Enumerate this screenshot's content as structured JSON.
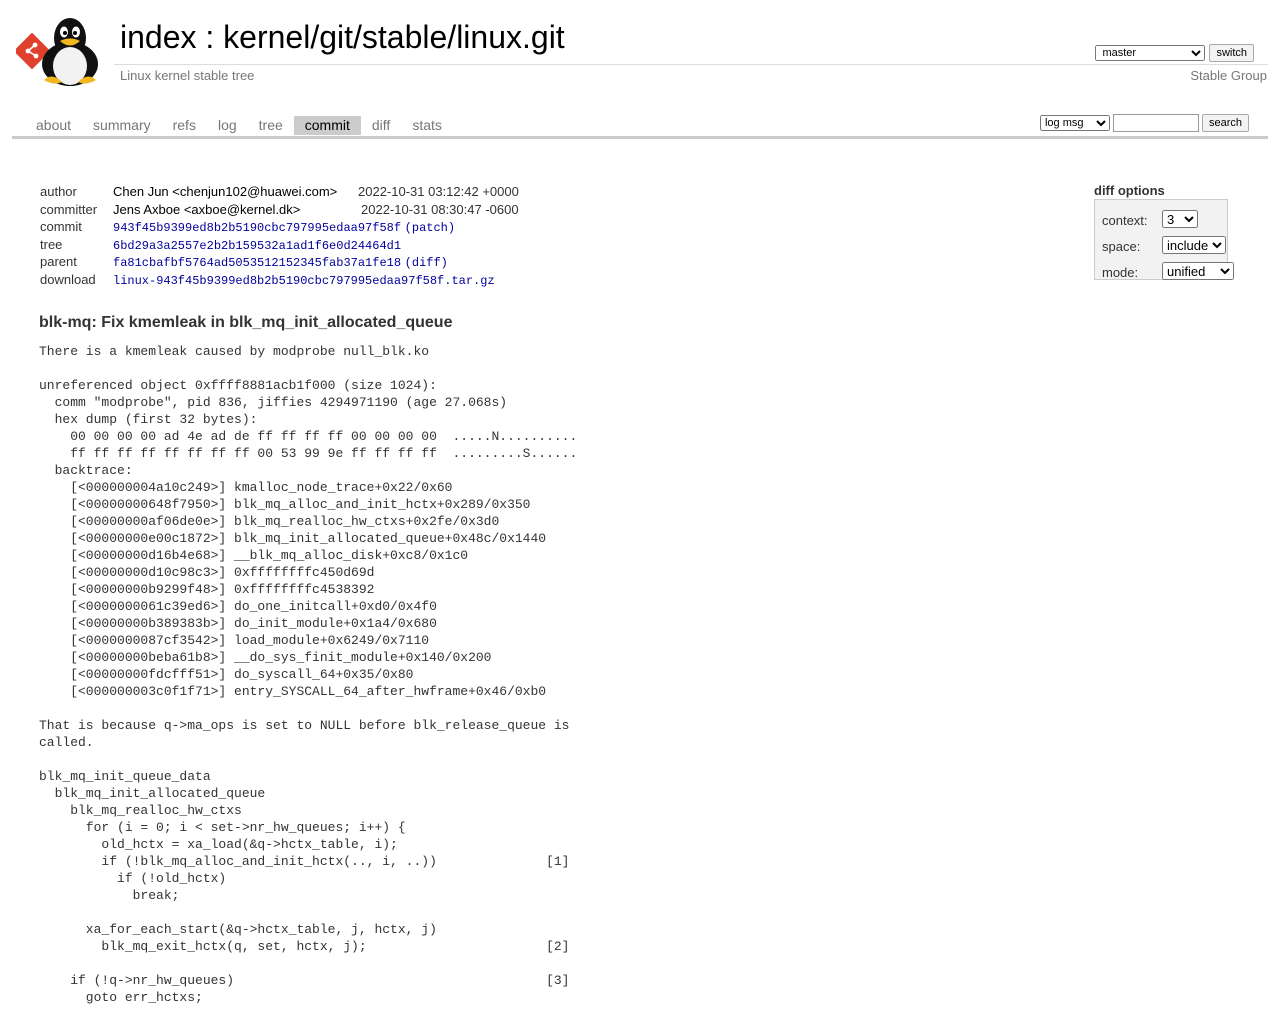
{
  "header": {
    "index_link": "index",
    "separator": " : ",
    "repo_link": "kernel/git/stable/linux.git",
    "subtitle": "Linux kernel stable tree",
    "owner": "Stable Group",
    "branch_selected": "master",
    "switch_label": "switch"
  },
  "tabs": [
    {
      "label": "about"
    },
    {
      "label": "summary"
    },
    {
      "label": "refs"
    },
    {
      "label": "log"
    },
    {
      "label": "tree"
    },
    {
      "label": "commit",
      "active": true
    },
    {
      "label": "diff"
    },
    {
      "label": "stats"
    }
  ],
  "search": {
    "mode_selected": "log msg",
    "query": "",
    "button_label": "search"
  },
  "diff_options": {
    "heading": "diff options",
    "context_label": "context:",
    "context_value": "3",
    "space_label": "space:",
    "space_value": "include",
    "mode_label": "mode:",
    "mode_value": "unified"
  },
  "commit_info": {
    "author_label": "author",
    "author": "Chen Jun <chenjun102@huawei.com>",
    "author_date": "2022-10-31 03:12:42 +0000",
    "committer_label": "committer",
    "committer": "Jens Axboe <axboe@kernel.dk>",
    "committer_date": "2022-10-31 08:30:47 -0600",
    "commit_label": "commit",
    "commit_hash": "943f45b9399ed8b2b5190cbc797995edaa97f58f",
    "patch_link": "(patch)",
    "tree_label": "tree",
    "tree_hash": "6bd29a3a2557e2b2b159532a1ad1f6e0d24464d1",
    "parent_label": "parent",
    "parent_hash": "fa81cbafbf5764ad5053512152345fab37a1fe18",
    "diff_link": "(diff)",
    "download_label": "download",
    "download_file": "linux-943f45b9399ed8b2b5190cbc797995edaa97f58f.tar.gz"
  },
  "subject": "blk-mq: Fix kmemleak in blk_mq_init_allocated_queue",
  "message": "There is a kmemleak caused by modprobe null_blk.ko\n\nunreferenced object 0xffff8881acb1f000 (size 1024):\n  comm \"modprobe\", pid 836, jiffies 4294971190 (age 27.068s)\n  hex dump (first 32 bytes):\n    00 00 00 00 ad 4e ad de ff ff ff ff 00 00 00 00  .....N..........\n    ff ff ff ff ff ff ff ff 00 53 99 9e ff ff ff ff  .........S......\n  backtrace:\n    [<000000004a10c249>] kmalloc_node_trace+0x22/0x60\n    [<00000000648f7950>] blk_mq_alloc_and_init_hctx+0x289/0x350\n    [<00000000af06de0e>] blk_mq_realloc_hw_ctxs+0x2fe/0x3d0\n    [<00000000e00c1872>] blk_mq_init_allocated_queue+0x48c/0x1440\n    [<00000000d16b4e68>] __blk_mq_alloc_disk+0xc8/0x1c0\n    [<00000000d10c98c3>] 0xffffffffc450d69d\n    [<00000000b9299f48>] 0xffffffffc4538392\n    [<0000000061c39ed6>] do_one_initcall+0xd0/0x4f0\n    [<00000000b389383b>] do_init_module+0x1a4/0x680\n    [<0000000087cf3542>] load_module+0x6249/0x7110\n    [<00000000beba61b8>] __do_sys_finit_module+0x140/0x200\n    [<00000000fdcfff51>] do_syscall_64+0x35/0x80\n    [<000000003c0f1f71>] entry_SYSCALL_64_after_hwframe+0x46/0xb0\n\nThat is because q->ma_ops is set to NULL before blk_release_queue is\ncalled.\n\nblk_mq_init_queue_data\n  blk_mq_init_allocated_queue\n    blk_mq_realloc_hw_ctxs\n      for (i = 0; i < set->nr_hw_queues; i++) {\n        old_hctx = xa_load(&q->hctx_table, i);\n        if (!blk_mq_alloc_and_init_hctx(.., i, ..))              [1]\n          if (!old_hctx)\n            break;\n\n      xa_for_each_start(&q->hctx_table, j, hctx, j)\n        blk_mq_exit_hctx(q, set, hctx, j);                       [2]\n\n    if (!q->nr_hw_queues)                                        [3]\n      goto err_hctxs;"
}
